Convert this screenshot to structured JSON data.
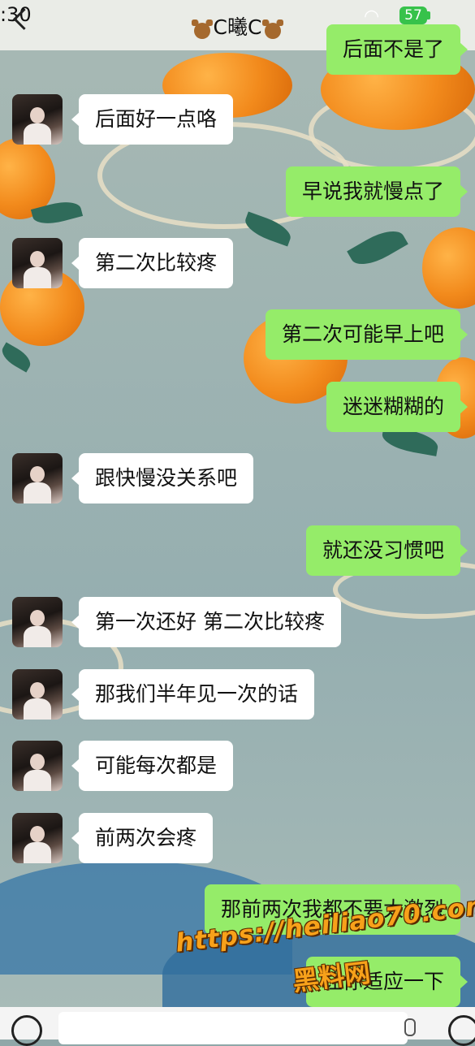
{
  "status_bar": {
    "time": ":30",
    "battery": "57"
  },
  "header": {
    "title": "C曦C"
  },
  "messages": [
    {
      "side": "out",
      "text": "后面不是了"
    },
    {
      "side": "in",
      "text": "后面好一点咯"
    },
    {
      "side": "out",
      "text": "早说我就慢点了"
    },
    {
      "side": "in",
      "text": "第二次比较疼"
    },
    {
      "side": "out",
      "text": "第二次可能早上吧"
    },
    {
      "side": "out",
      "text": "迷迷糊糊的"
    },
    {
      "side": "in",
      "text": "跟快慢没关系吧"
    },
    {
      "side": "out",
      "text": "就还没习惯吧"
    },
    {
      "side": "in",
      "text": "第一次还好 第二次比较疼"
    },
    {
      "side": "in",
      "text": "那我们半年见一次的话"
    },
    {
      "side": "in",
      "text": "可能每次都是"
    },
    {
      "side": "in",
      "text": "前两次会疼"
    },
    {
      "side": "out",
      "text": "那前两次我都不要太激烈"
    },
    {
      "side": "out",
      "text": "让你适应一下"
    }
  ],
  "watermark": {
    "url": "https://heiliao70.com",
    "site": "黑料网"
  },
  "colors": {
    "incoming_bubble": "#ffffff",
    "outgoing_bubble": "#95ec69",
    "watermark": "#f7a11a"
  },
  "icons": [
    "back-icon",
    "bear-icon",
    "wifi-icon",
    "battery-icon",
    "voice-icon",
    "mic-icon",
    "emoji-icon"
  ]
}
